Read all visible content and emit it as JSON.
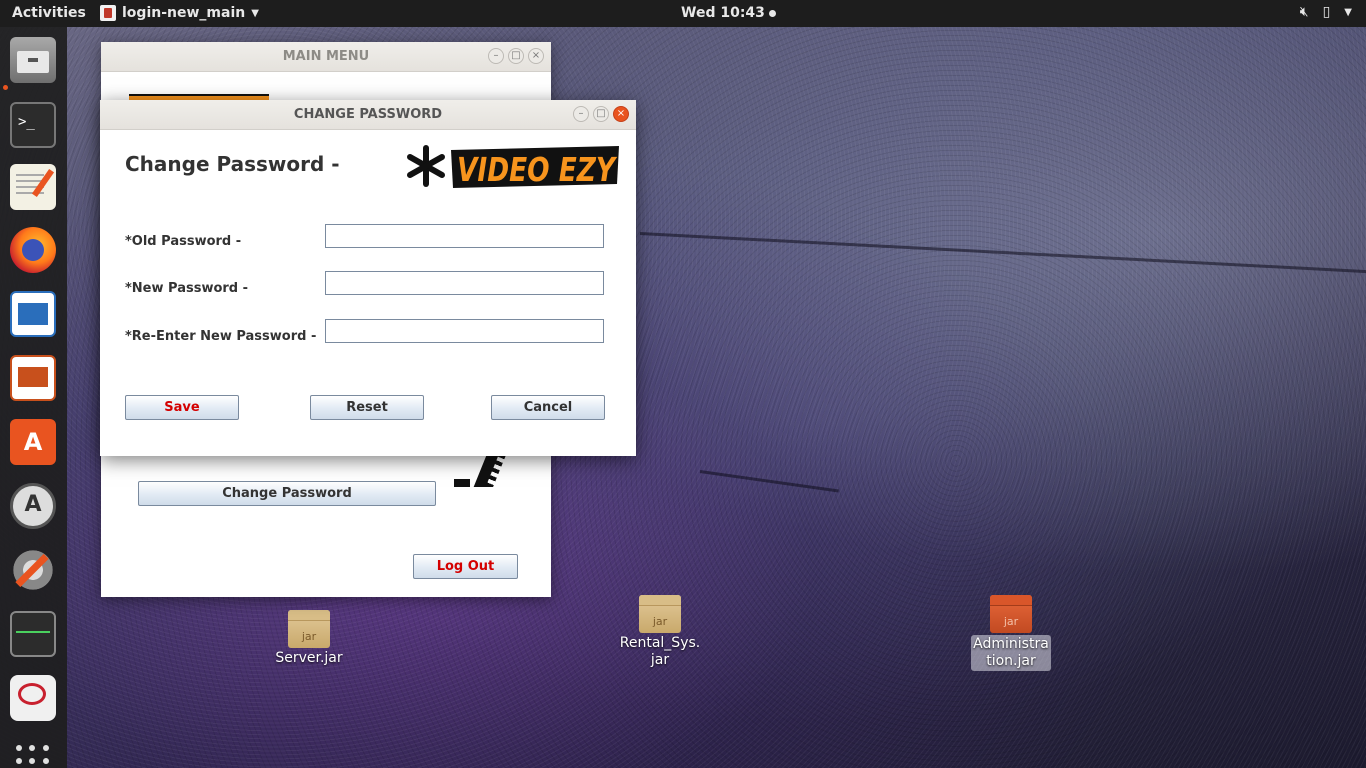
{
  "topbar": {
    "activities": "Activities",
    "app_name": "login-new_main",
    "clock": "Wed 10:43"
  },
  "dock": {
    "items": [
      {
        "name": "files-icon"
      },
      {
        "name": "terminal-icon"
      },
      {
        "name": "text-editor-icon"
      },
      {
        "name": "firefox-icon"
      },
      {
        "name": "writer-icon"
      },
      {
        "name": "impress-icon"
      },
      {
        "name": "software-center-icon"
      },
      {
        "name": "software-updater-icon"
      },
      {
        "name": "settings-icon"
      },
      {
        "name": "system-monitor-icon"
      },
      {
        "name": "remote-desktop-icon"
      }
    ]
  },
  "main_menu": {
    "title": "MAIN MENU",
    "change_password_label": "Change Password",
    "logout_label": "Log Out"
  },
  "dialog": {
    "window_title": "CHANGE PASSWORD",
    "heading": "Change Password -",
    "logo_text": "VIDEO EZY",
    "fields": [
      {
        "label": "*Old Password -",
        "value": ""
      },
      {
        "label": "*New Password -",
        "value": ""
      },
      {
        "label": "*Re-Enter New Password -",
        "value": ""
      }
    ],
    "save_label": "Save",
    "reset_label": "Reset",
    "cancel_label": "Cancel"
  },
  "desktop": {
    "icons": [
      {
        "label": "Server.jar",
        "badge": "jar"
      },
      {
        "label": "Rental_Sys.\njar",
        "badge": "jar"
      },
      {
        "label": "Administra\ntion.jar",
        "badge": "jar"
      }
    ]
  },
  "colors": {
    "topbar": "#1d1d1d",
    "dock": "#1e1e1e",
    "accent": "#e95420",
    "danger_text": "#d40000",
    "logo_orange": "#f7941d"
  }
}
